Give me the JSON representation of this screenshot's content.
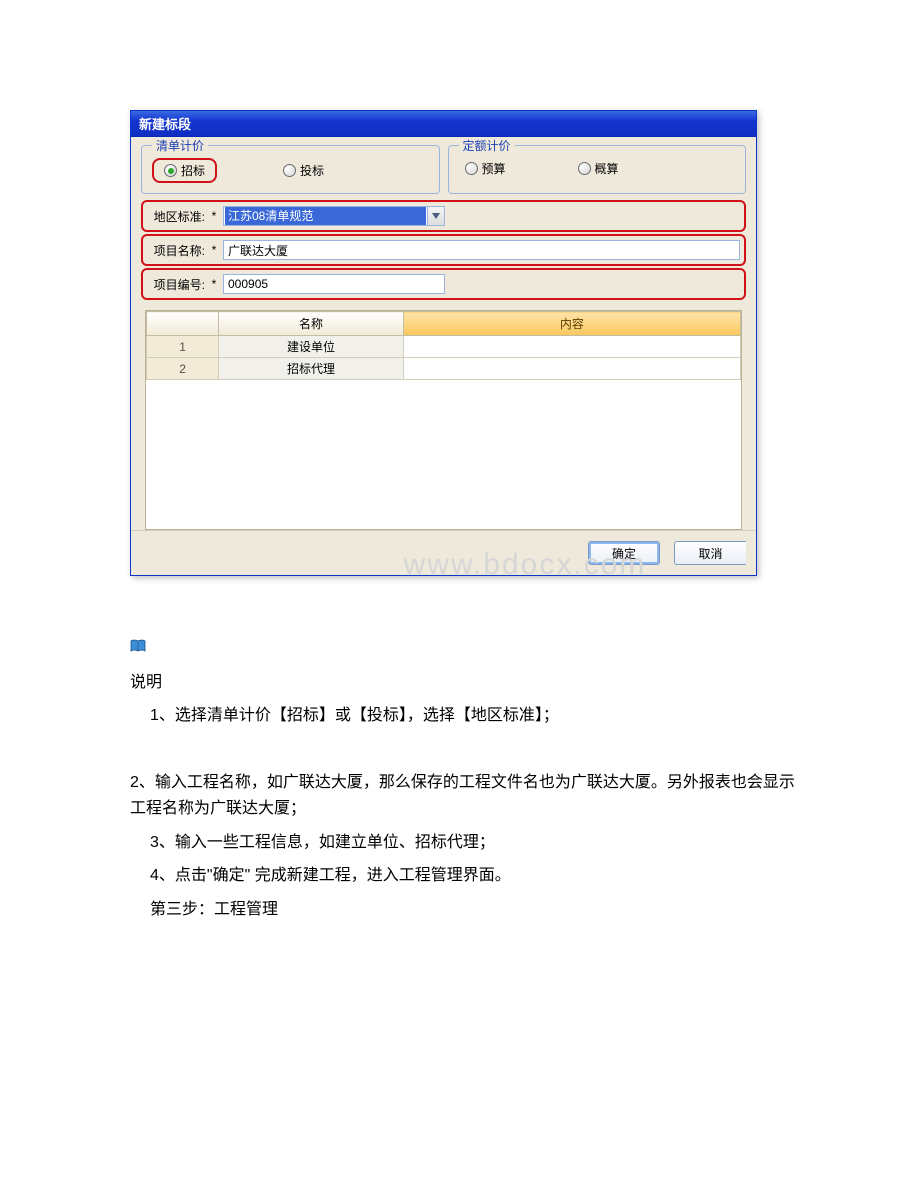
{
  "dialog": {
    "title": "新建标段",
    "group1": {
      "legend": "清单计价",
      "radios": [
        {
          "label": "招标",
          "checked": true,
          "highlight": true
        },
        {
          "label": "投标",
          "checked": false,
          "highlight": false
        }
      ]
    },
    "group2": {
      "legend": "定额计价",
      "radios": [
        {
          "label": "预算",
          "checked": false
        },
        {
          "label": "概算",
          "checked": false
        }
      ]
    },
    "fields": {
      "region_label": "地区标准:",
      "region_value": "江苏08清单规范",
      "name_label": "项目名称:",
      "name_value": "广联达大厦",
      "code_label": "项目编号:",
      "code_value": "000905",
      "asterisk": "*"
    },
    "grid": {
      "headers": {
        "index": "",
        "name": "名称",
        "content": "内容"
      },
      "rows": [
        {
          "index": "1",
          "name": "建设单位",
          "content": ""
        },
        {
          "index": "2",
          "name": "招标代理",
          "content": ""
        }
      ]
    },
    "buttons": {
      "ok": "确定",
      "cancel": "取消"
    }
  },
  "watermark": "www.bdocx.com",
  "doc": {
    "heading": "说明",
    "p1": "1、选择清单计价【招标】或【投标】，选择【地区标准】；",
    "p2": "2、输入工程名称，如广联达大厦，那么保存的工程文件名也为广联达大厦。另外报表也会显示工程名称为广联达大厦；",
    "p3": "3、输入一些工程信息，如建立单位、招标代理；",
    "p4": "4、点击\"确定\" 完成新建工程，进入工程管理界面。",
    "p5": "第三步：工程管理"
  }
}
